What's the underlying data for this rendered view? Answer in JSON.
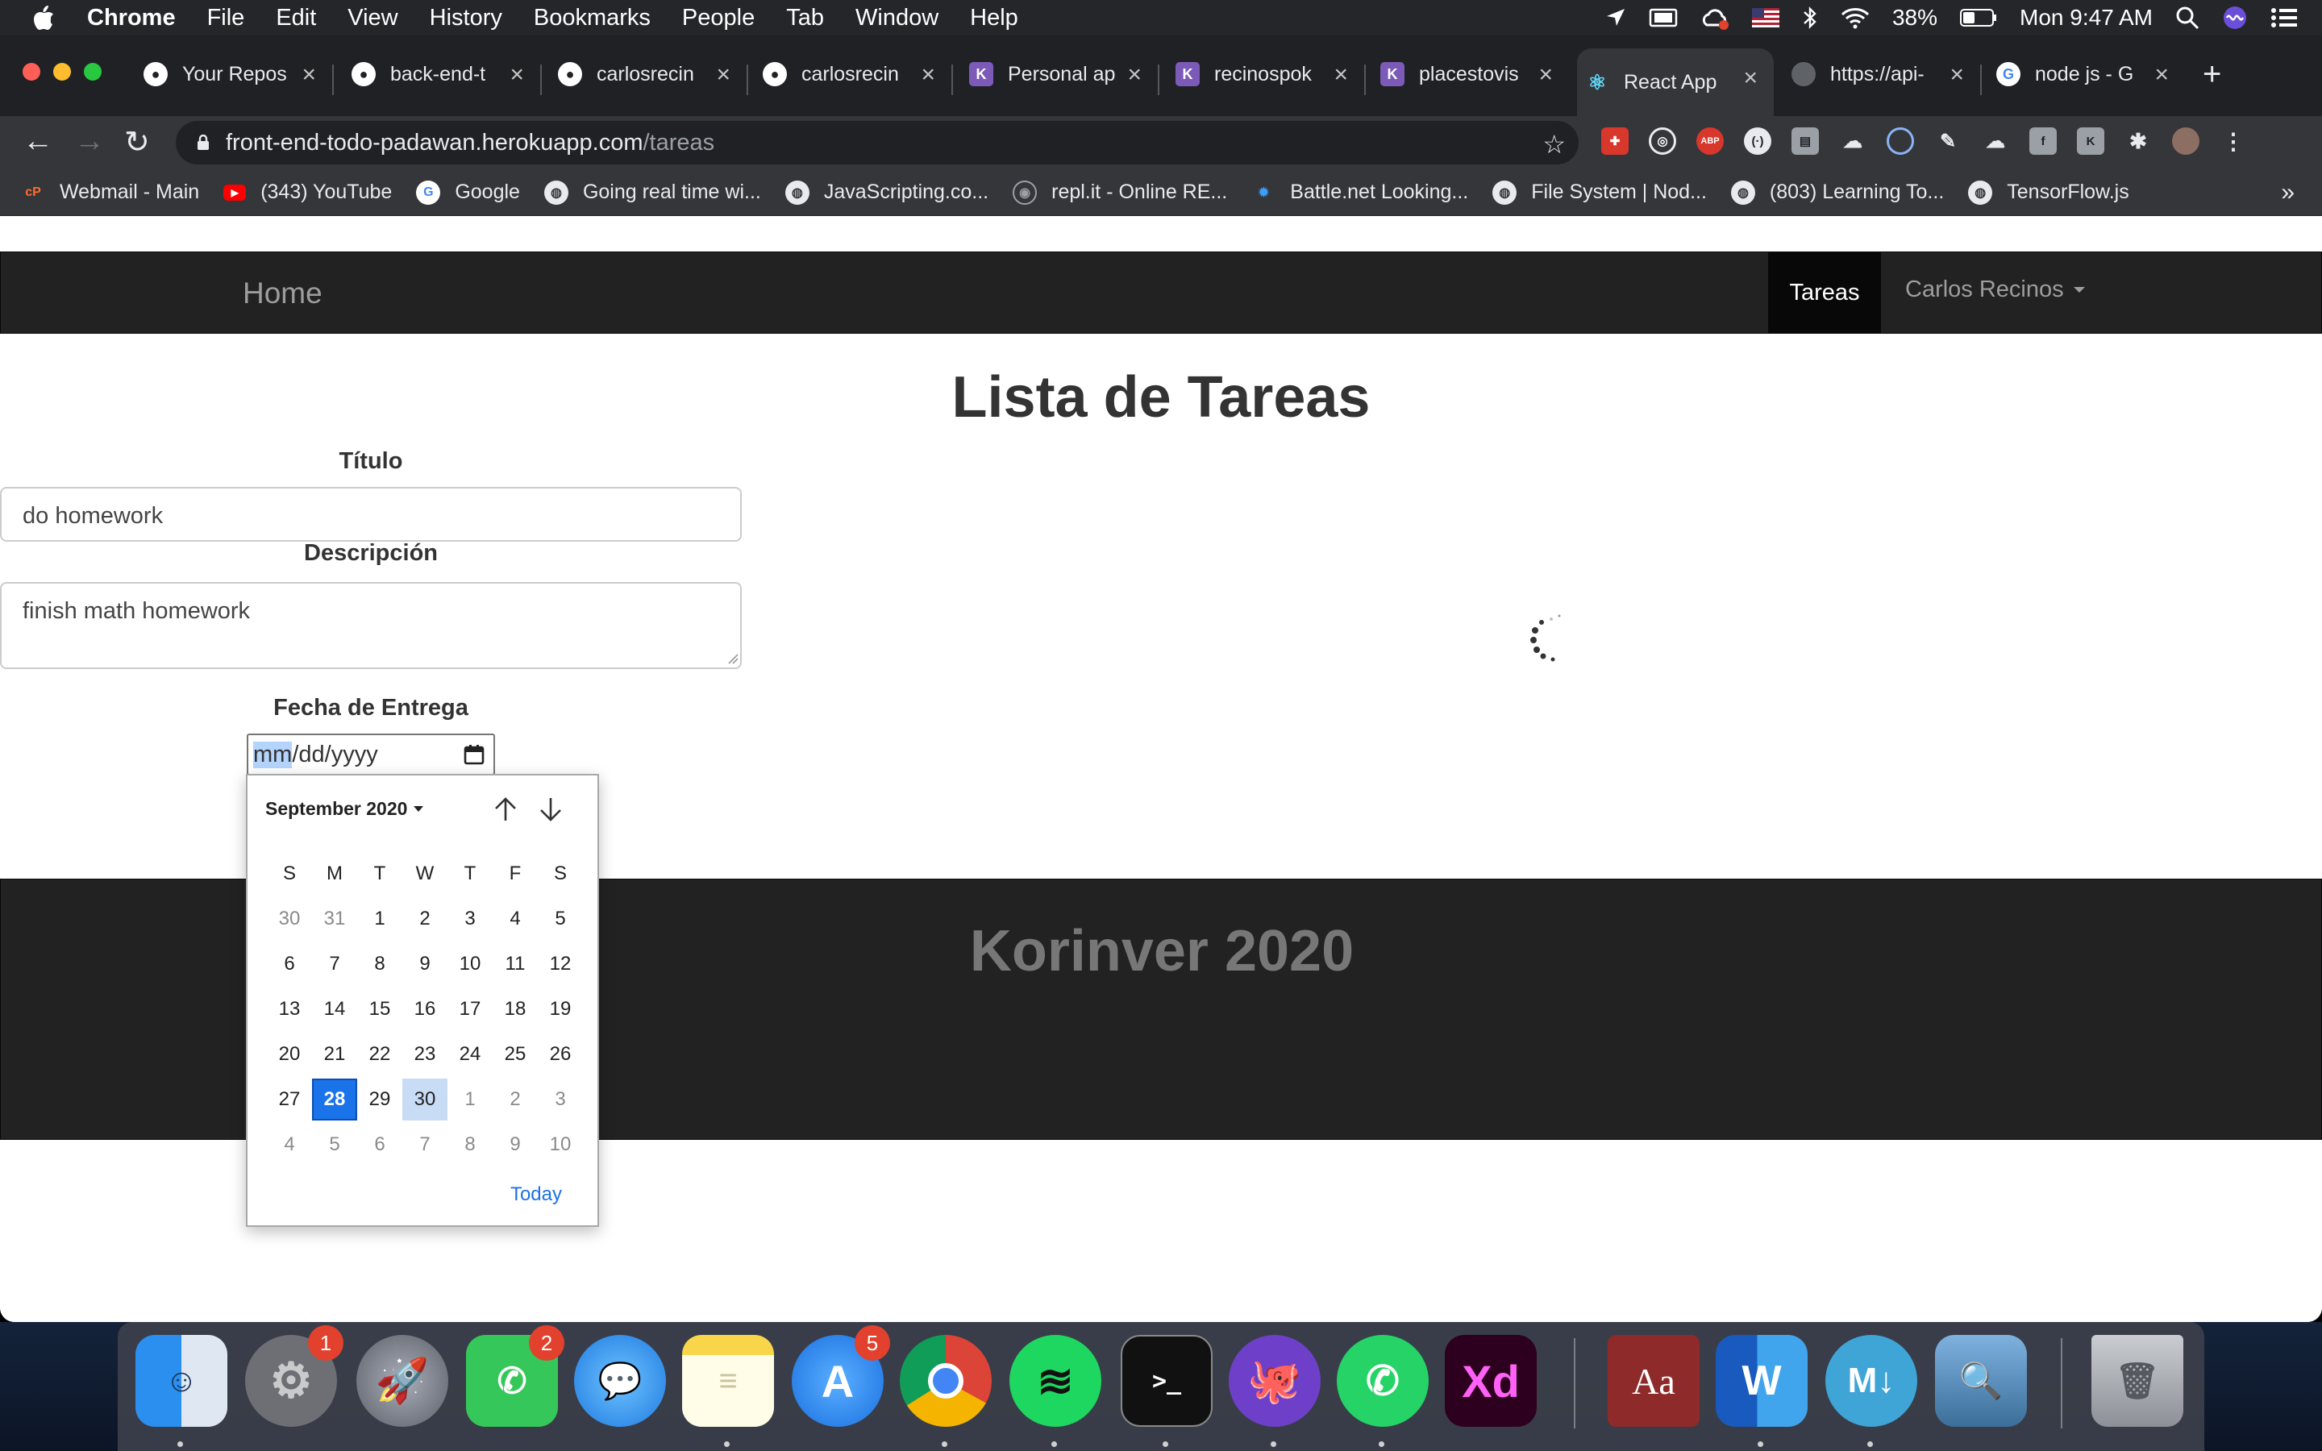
{
  "menubar": {
    "items": [
      "Chrome",
      "File",
      "Edit",
      "View",
      "History",
      "Bookmarks",
      "People",
      "Tab",
      "Window",
      "Help"
    ],
    "battery": "38%",
    "clock": "Mon 9:47 AM"
  },
  "tabs": [
    {
      "title": "Your Repos",
      "favicon": "github-icon"
    },
    {
      "title": "back-end-t",
      "favicon": "github-icon"
    },
    {
      "title": "carlosrecin",
      "favicon": "github-icon"
    },
    {
      "title": "carlosrecin",
      "favicon": "github-icon"
    },
    {
      "title": "Personal ap",
      "favicon": "heroku-icon"
    },
    {
      "title": "recinospok",
      "favicon": "heroku-icon"
    },
    {
      "title": "placestovis",
      "favicon": "heroku-icon"
    },
    {
      "title": "React App",
      "favicon": "react-icon"
    },
    {
      "title": "https://api-",
      "favicon": "globe-icon"
    },
    {
      "title": "node js - G",
      "favicon": "google-icon"
    }
  ],
  "address": {
    "host": "front-end-todo-padawan.herokuapp.com",
    "path": "/tareas"
  },
  "bookmarks": [
    {
      "label": "Webmail - Main",
      "icon": "cpanel-icon"
    },
    {
      "label": "(343) YouTube",
      "icon": "youtube-icon"
    },
    {
      "label": "Google",
      "icon": "google-icon"
    },
    {
      "label": "Going real time wi...",
      "icon": "globe-icon"
    },
    {
      "label": "JavaScripting.co...",
      "icon": "globe-icon"
    },
    {
      "label": "repl.it - Online RE...",
      "icon": "replit-icon"
    },
    {
      "label": "Battle.net Looking...",
      "icon": "battlenet-icon"
    },
    {
      "label": "File System | Nod...",
      "icon": "globe-icon"
    },
    {
      "label": "(803) Learning To...",
      "icon": "globe-icon"
    },
    {
      "label": "TensorFlow.js",
      "icon": "globe-icon"
    }
  ],
  "navbar": {
    "brand": "Home",
    "active_item": "Tareas",
    "user_menu": "Carlos Recinos"
  },
  "page": {
    "title": "Lista de Tareas"
  },
  "form": {
    "titulo_label": "Título",
    "titulo_value": "do homework",
    "descripcion_label": "Descripción",
    "descripcion_value": "finish math homework",
    "fecha_label": "Fecha de Entrega",
    "fecha_mm": "mm",
    "fecha_rest": "/dd/yyyy"
  },
  "datepicker": {
    "month_label": "September 2020",
    "weekdays": [
      "S",
      "M",
      "T",
      "W",
      "T",
      "F",
      "S"
    ],
    "weeks": [
      [
        "30",
        "31",
        "1",
        "2",
        "3",
        "4",
        "5"
      ],
      [
        "6",
        "7",
        "8",
        "9",
        "10",
        "11",
        "12"
      ],
      [
        "13",
        "14",
        "15",
        "16",
        "17",
        "18",
        "19"
      ],
      [
        "20",
        "21",
        "22",
        "23",
        "24",
        "25",
        "26"
      ],
      [
        "27",
        "28",
        "29",
        "30",
        "1",
        "2",
        "3"
      ],
      [
        "4",
        "5",
        "6",
        "7",
        "8",
        "9",
        "10"
      ]
    ],
    "selected_day": "28",
    "hover_day": "30",
    "today_label": "Today"
  },
  "footer": {
    "text": "Korinver 2020"
  },
  "dock": {
    "apps": [
      {
        "name": "finder-icon"
      },
      {
        "name": "system-preferences-icon",
        "badge": "1"
      },
      {
        "name": "launchpad-icon"
      },
      {
        "name": "facetime-icon",
        "badge": "2"
      },
      {
        "name": "messages-icon"
      },
      {
        "name": "notes-icon"
      },
      {
        "name": "app-store-icon",
        "badge": "5"
      },
      {
        "name": "chrome-icon"
      },
      {
        "name": "spotify-icon"
      },
      {
        "name": "terminal-icon"
      },
      {
        "name": "github-desktop-icon"
      },
      {
        "name": "whatsapp-icon"
      },
      {
        "name": "adobe-xd-icon",
        "label": "Xd"
      },
      {
        "name": "dictionary-icon",
        "label": "Aa"
      },
      {
        "name": "word-icon",
        "label": "W"
      },
      {
        "name": "markdown-icon",
        "label": "M↓"
      },
      {
        "name": "preview-icon"
      },
      {
        "name": "trash-icon"
      }
    ]
  }
}
